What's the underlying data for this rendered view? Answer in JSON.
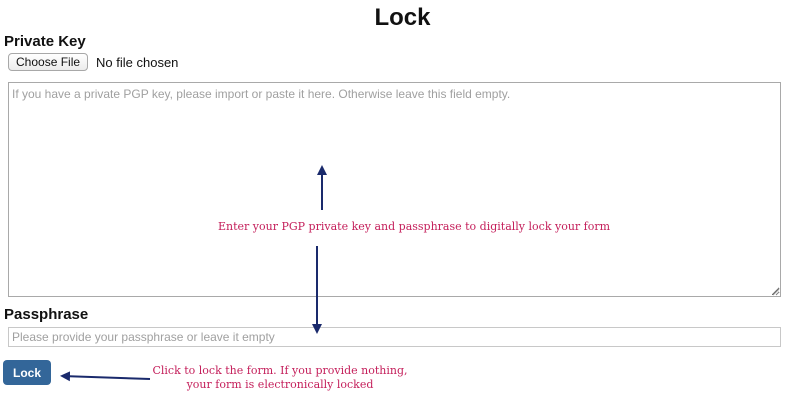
{
  "page": {
    "title": "Lock"
  },
  "private_key": {
    "label": "Private Key",
    "file_button_label": "Choose File",
    "file_status": "No file chosen",
    "textarea_placeholder": "If you have a private PGP key, please import or paste it here. Otherwise leave this field empty."
  },
  "passphrase": {
    "label": "Passphrase",
    "placeholder": "Please provide your passphrase or leave it empty"
  },
  "actions": {
    "lock_label": "Lock"
  },
  "annotations": {
    "key_hint": "Enter your PGP private key and passphrase to digitally lock your form",
    "lock_hint_line1": "Click to lock the form. If you provide nothing,",
    "lock_hint_line2": "your form is electronically locked",
    "text_color": "#c41e5a",
    "arrow_color": "#1a2a6c"
  },
  "colors": {
    "lock_button_bg": "#336699"
  }
}
